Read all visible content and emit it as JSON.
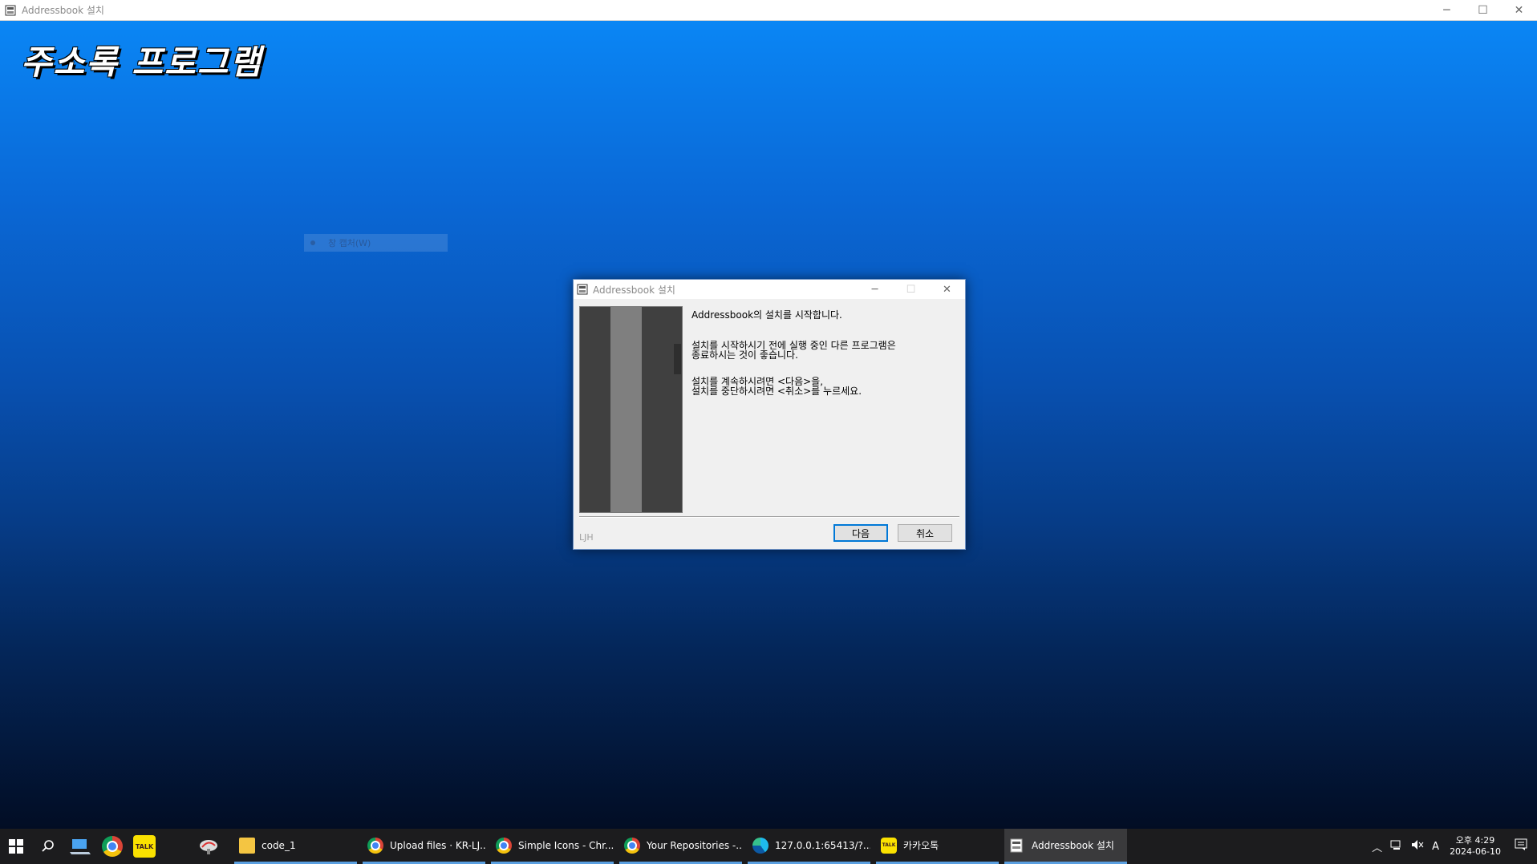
{
  "window": {
    "title": "Addressbook 설치",
    "controls": [
      "─",
      "☐",
      "✕"
    ]
  },
  "installer": {
    "heading": "주소록 프로그램",
    "ghost_menu": "창 캡처(W)"
  },
  "dialog": {
    "title": "Addressbook 설치",
    "controls": [
      "─",
      "☐",
      "✕"
    ],
    "messages": {
      "line1": "Addressbook의 설치를 시작합니다.",
      "line2": "설치를 시작하시기 전에 실행 중인 다른 프로그램은",
      "line3": "종료하시는 것이 좋습니다.",
      "line4": "설치를 계속하시려면 <다음>을,",
      "line5": "설치를 중단하시려면 <취소>를 누르세요."
    },
    "brand": "LJH",
    "buttons": {
      "next": "다음",
      "cancel": "취소"
    }
  },
  "taskbar": {
    "tasks": [
      {
        "label": "code_1",
        "icon": "folder-icon"
      },
      {
        "label": "Upload files · KR-LJ...",
        "icon": "chrome-icon"
      },
      {
        "label": "Simple Icons - Chr...",
        "icon": "chrome-icon"
      },
      {
        "label": "Your Repositories -...",
        "icon": "chrome-icon"
      },
      {
        "label": "127.0.0.1:65413/?...",
        "icon": "edge-icon"
      },
      {
        "label": "카카오톡",
        "icon": "kakaotalk-icon"
      },
      {
        "label": "Addressbook 설치",
        "icon": "installer-icon"
      }
    ],
    "tray": {
      "ime": "A",
      "time": "오후 4:29",
      "date": "2024-06-10"
    }
  },
  "colors": {
    "gradient_top": "#0a86f5",
    "gradient_bottom": "#020d24",
    "taskbar": "#1c1c1e",
    "accent": "#0078d7"
  }
}
